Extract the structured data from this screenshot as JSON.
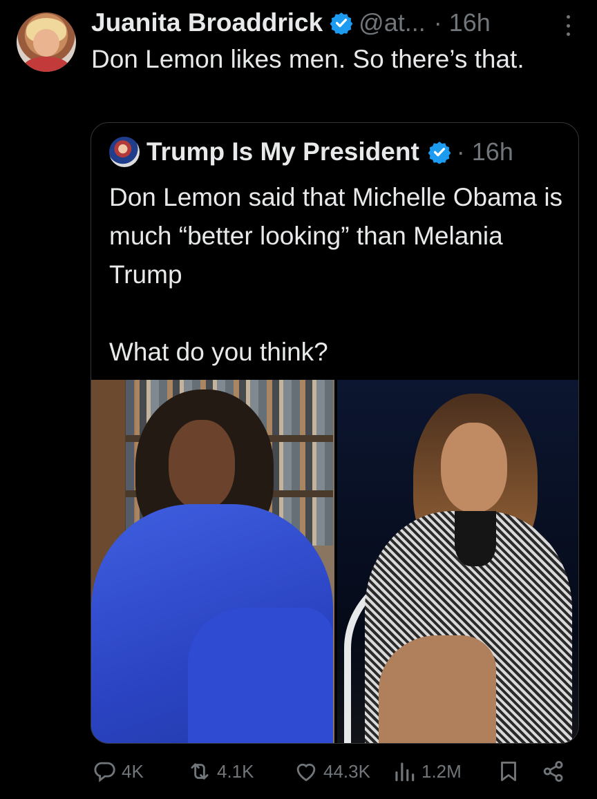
{
  "tweet": {
    "author_name": "Juanita Broaddrick",
    "handle": "@at...",
    "time": "· 16h",
    "text": "Don Lemon likes men.   So there’s that."
  },
  "quoted_tweet": {
    "author_name": "Trump Is My President",
    "time": "· 16h",
    "text_line1": "Don Lemon said that Michelle Obama is much “better looking” than Melania Trump",
    "text_line2": "What do you think?"
  },
  "actions": {
    "replies": "4K",
    "retweets": "4.1K",
    "likes": "44.3K",
    "views": "1.2M"
  },
  "icons": [
    "verified-badge-icon",
    "more-icon",
    "reply-icon",
    "retweet-icon",
    "like-icon",
    "views-icon",
    "bookmark-icon",
    "share-icon"
  ],
  "colors": {
    "background": "#000000",
    "text": "#e7e9ea",
    "muted": "#71767b",
    "verified": "#1d9bf0",
    "border": "#333639"
  }
}
